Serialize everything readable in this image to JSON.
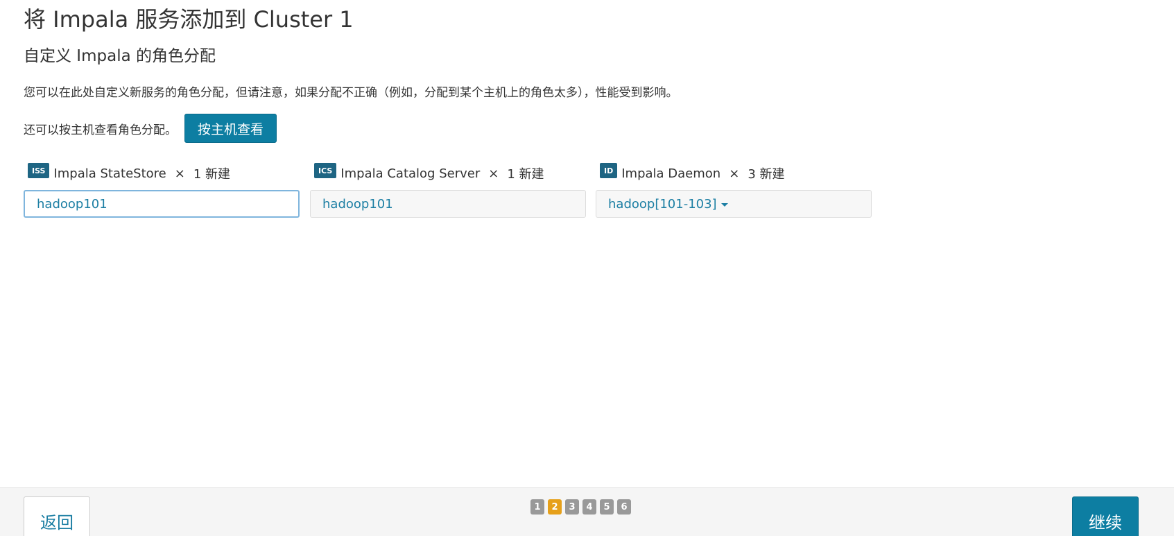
{
  "page": {
    "title": "将 Impala 服务添加到 Cluster 1",
    "subtitle": "自定义 Impala 的角色分配",
    "description": "您可以在此处自定义新服务的角色分配，但请注意，如果分配不正确（例如，分配到某个主机上的角色太多），性能受到影响。",
    "host_view_text": "还可以按主机查看角色分配。",
    "host_view_button": "按主机查看"
  },
  "roles": [
    {
      "badge": "ISS",
      "name": "Impala StateStore",
      "times": "×",
      "count": "1 新建",
      "hosts": "hadoop101"
    },
    {
      "badge": "ICS",
      "name": "Impala Catalog Server",
      "times": "×",
      "count": "1 新建",
      "hosts": "hadoop101"
    },
    {
      "badge": "ID",
      "name": "Impala Daemon",
      "times": "×",
      "count": "3 新建",
      "hosts": "hadoop[101-103]"
    }
  ],
  "footer": {
    "back_label": "返回",
    "continue_label": "继续",
    "steps": [
      "1",
      "2",
      "3",
      "4",
      "5",
      "6"
    ],
    "active_step": "2"
  },
  "colors": {
    "primary": "#0d7ea2",
    "badge": "#1e6583",
    "step_active": "#e6a01a",
    "step_inactive": "#999999",
    "link": "#1b7ea3"
  }
}
